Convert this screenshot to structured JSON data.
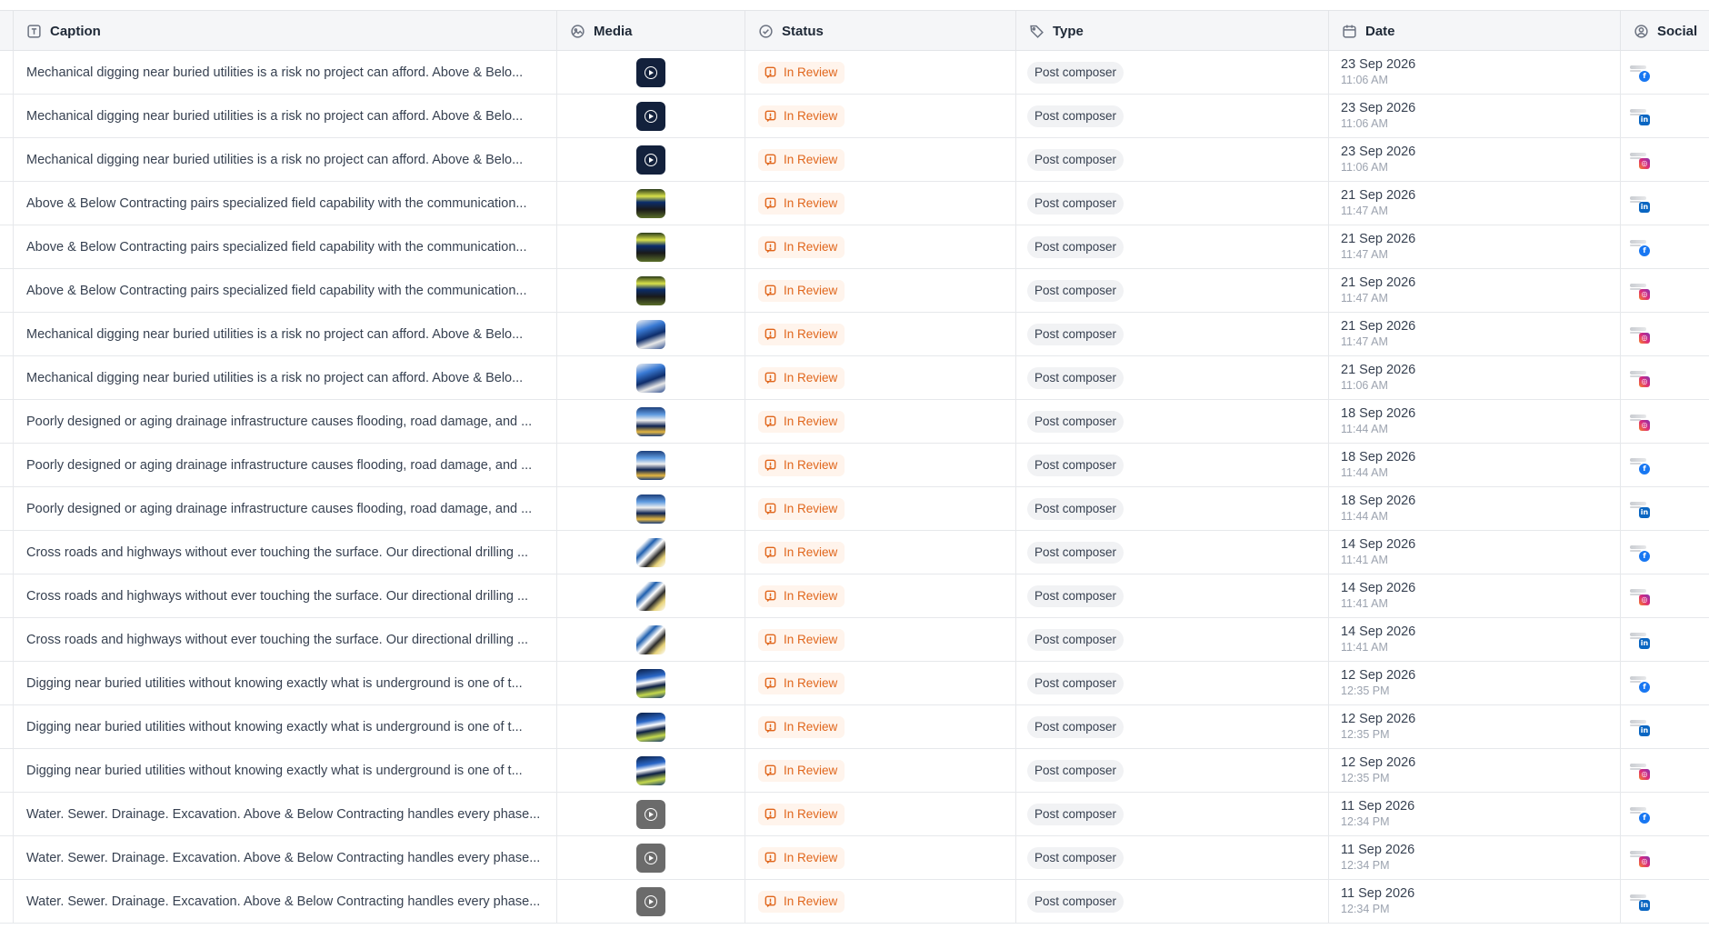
{
  "columns": {
    "caption": "Caption",
    "media": "Media",
    "status": "Status",
    "type": "Type",
    "date": "Date",
    "social": "Social"
  },
  "colors": {
    "status_text": "#e0661c",
    "status_bg": "#fff4ec",
    "facebook": "#1877f2",
    "linkedin": "#0a66c2",
    "instagram": "#dd2a7b"
  },
  "rows": [
    {
      "caption": "Mechanical digging near buried utilities is a risk no project can afford. Above & Belo...",
      "media": "video-dark",
      "status": "In Review",
      "type": "Post composer",
      "date": "23 Sep 2026",
      "time": "11:06 AM",
      "social": "facebook"
    },
    {
      "caption": "Mechanical digging near buried utilities is a risk no project can afford. Above & Belo...",
      "media": "video-dark",
      "status": "In Review",
      "type": "Post composer",
      "date": "23 Sep 2026",
      "time": "11:06 AM",
      "social": "linkedin"
    },
    {
      "caption": "Mechanical digging near buried utilities is a risk no project can afford. Above & Belo...",
      "media": "video-dark",
      "status": "In Review",
      "type": "Post composer",
      "date": "23 Sep 2026",
      "time": "11:06 AM",
      "social": "instagram"
    },
    {
      "caption": "Above & Below Contracting pairs specialized field capability with the communication...",
      "media": "photo-a",
      "status": "In Review",
      "type": "Post composer",
      "date": "21 Sep 2026",
      "time": "11:47 AM",
      "social": "linkedin"
    },
    {
      "caption": "Above & Below Contracting pairs specialized field capability with the communication...",
      "media": "photo-a",
      "status": "In Review",
      "type": "Post composer",
      "date": "21 Sep 2026",
      "time": "11:47 AM",
      "social": "facebook"
    },
    {
      "caption": "Above & Below Contracting pairs specialized field capability with the communication...",
      "media": "photo-a",
      "status": "In Review",
      "type": "Post composer",
      "date": "21 Sep 2026",
      "time": "11:47 AM",
      "social": "instagram"
    },
    {
      "caption": "Mechanical digging near buried utilities is a risk no project can afford. Above & Belo...",
      "media": "photo-b",
      "status": "In Review",
      "type": "Post composer",
      "date": "21 Sep 2026",
      "time": "11:47 AM",
      "social": "instagram"
    },
    {
      "caption": "Mechanical digging near buried utilities is a risk no project can afford. Above & Belo...",
      "media": "photo-b",
      "status": "In Review",
      "type": "Post composer",
      "date": "21 Sep 2026",
      "time": "11:06 AM",
      "social": "instagram"
    },
    {
      "caption": "Poorly designed or aging drainage infrastructure causes flooding, road damage, and ...",
      "media": "photo-c",
      "status": "In Review",
      "type": "Post composer",
      "date": "18 Sep 2026",
      "time": "11:44 AM",
      "social": "instagram"
    },
    {
      "caption": "Poorly designed or aging drainage infrastructure causes flooding, road damage, and ...",
      "media": "photo-c",
      "status": "In Review",
      "type": "Post composer",
      "date": "18 Sep 2026",
      "time": "11:44 AM",
      "social": "facebook"
    },
    {
      "caption": "Poorly designed or aging drainage infrastructure causes flooding, road damage, and ...",
      "media": "photo-c",
      "status": "In Review",
      "type": "Post composer",
      "date": "18 Sep 2026",
      "time": "11:44 AM",
      "social": "linkedin"
    },
    {
      "caption": "Cross roads and highways without ever touching the surface. Our directional drilling ...",
      "media": "photo-d",
      "status": "In Review",
      "type": "Post composer",
      "date": "14 Sep 2026",
      "time": "11:41 AM",
      "social": "facebook"
    },
    {
      "caption": "Cross roads and highways without ever touching the surface. Our directional drilling ...",
      "media": "photo-d",
      "status": "In Review",
      "type": "Post composer",
      "date": "14 Sep 2026",
      "time": "11:41 AM",
      "social": "instagram"
    },
    {
      "caption": "Cross roads and highways without ever touching the surface. Our directional drilling ...",
      "media": "photo-d",
      "status": "In Review",
      "type": "Post composer",
      "date": "14 Sep 2026",
      "time": "11:41 AM",
      "social": "linkedin"
    },
    {
      "caption": "Digging near buried utilities without knowing exactly what is underground is one of t...",
      "media": "photo-e",
      "status": "In Review",
      "type": "Post composer",
      "date": "12 Sep 2026",
      "time": "12:35 PM",
      "social": "facebook"
    },
    {
      "caption": "Digging near buried utilities without knowing exactly what is underground is one of t...",
      "media": "photo-e",
      "status": "In Review",
      "type": "Post composer",
      "date": "12 Sep 2026",
      "time": "12:35 PM",
      "social": "linkedin"
    },
    {
      "caption": "Digging near buried utilities without knowing exactly what is underground is one of t...",
      "media": "photo-e",
      "status": "In Review",
      "type": "Post composer",
      "date": "12 Sep 2026",
      "time": "12:35 PM",
      "social": "instagram"
    },
    {
      "caption": "Water. Sewer. Drainage. Excavation. Above & Below Contracting handles every phase...",
      "media": "video-gray",
      "status": "In Review",
      "type": "Post composer",
      "date": "11 Sep 2026",
      "time": "12:34 PM",
      "social": "facebook"
    },
    {
      "caption": "Water. Sewer. Drainage. Excavation. Above & Below Contracting handles every phase...",
      "media": "video-gray",
      "status": "In Review",
      "type": "Post composer",
      "date": "11 Sep 2026",
      "time": "12:34 PM",
      "social": "instagram"
    },
    {
      "caption": "Water. Sewer. Drainage. Excavation. Above & Below Contracting handles every phase...",
      "media": "video-gray",
      "status": "In Review",
      "type": "Post composer",
      "date": "11 Sep 2026",
      "time": "12:34 PM",
      "social": "linkedin"
    }
  ]
}
